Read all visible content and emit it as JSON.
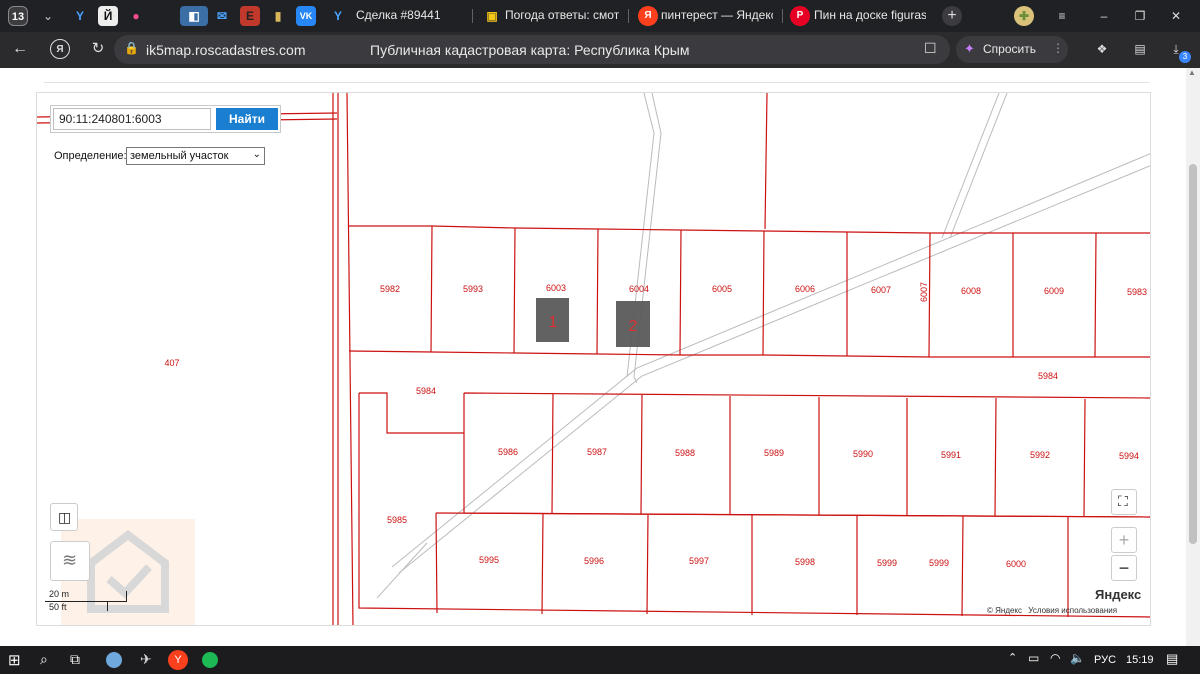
{
  "tabs": {
    "counter": "13",
    "items": [
      {
        "title": "Сделка #89441"
      },
      {
        "title": "Погода ответы: смотр"
      },
      {
        "title": "пинтерест — Яндекс:"
      },
      {
        "title": "Пин на доске figuras"
      }
    ]
  },
  "address": {
    "url": "ik5map.roscadastres.com",
    "page_title": "Публичная кадастровая карта: Республика Крым",
    "ask_label": "Спросить",
    "downloads_badge": "3"
  },
  "search": {
    "query": "90:11:240801:6003",
    "button": "Найти",
    "definition_label": "Определение:",
    "definition_value": "земельный участок"
  },
  "map": {
    "parcels_row1": [
      "5982",
      "5993",
      "6003",
      "6004",
      "6005",
      "6006",
      "6007",
      "6008",
      "6009",
      "5983"
    ],
    "parcel_6007_vertical": "6007",
    "markers": [
      "1",
      "2"
    ],
    "label_407": "407",
    "label_5984_left": "5984",
    "label_5984_right": "5984",
    "parcels_row2": [
      "5986",
      "5987",
      "5988",
      "5989",
      "5990",
      "5991",
      "5992",
      "5994"
    ],
    "label_5985": "5985",
    "parcels_row3": [
      "5995",
      "5996",
      "5997",
      "5998",
      "5999",
      "5999",
      "6000"
    ],
    "scale_m": "20 m",
    "scale_ft": "50 ft",
    "zoom_in": "+",
    "zoom_out": "−",
    "yandex_logo": "Яндекс",
    "copyright": "© Яндекс",
    "terms": "Условия использования"
  },
  "taskbar": {
    "lang": "РУС",
    "time": "15:19"
  },
  "colors": {
    "parcel_line": "#cc1111",
    "button_blue": "#1a7fd0",
    "marker_gray": "#5a5a5a"
  }
}
